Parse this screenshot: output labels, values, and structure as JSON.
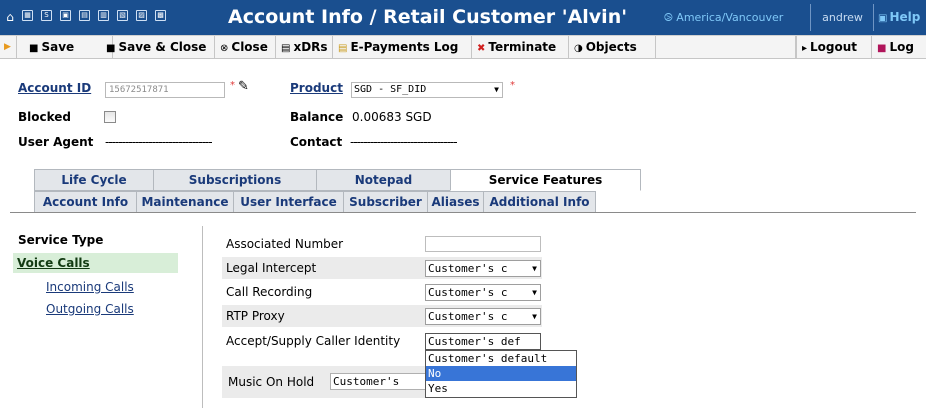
{
  "titlebar": {
    "title": "Account Info / Retail Customer 'Alvin'",
    "timezone": "⧁ America/Vancouver",
    "user": "andrew",
    "help": "Help",
    "home_icon": "⌂",
    "quick_icons": [
      "▦",
      "S",
      "▣",
      "▤",
      "▥",
      "▧",
      "▨",
      "▩"
    ]
  },
  "toolbar": {
    "save": "Save",
    "save_close": "Save & Close",
    "close": "Close",
    "xdrs": "xDRs",
    "epayments": "E-Payments Log",
    "terminate": "Terminate",
    "objects": "Objects",
    "logout": "Logout",
    "log": "Log",
    "icons": {
      "save": "■",
      "save_close": "■",
      "close": "⊗",
      "xdrs": "▤",
      "epayments": "▤",
      "terminate": "✖",
      "objects": "◑",
      "logout": "▸",
      "log": "■"
    },
    "icon_colors": {
      "terminate": "#d0201e",
      "log": "#b0145a",
      "epayments": "#c99a1a"
    }
  },
  "header": {
    "account_id_label": "Account ID",
    "account_id_value": "15672517871",
    "product_label": "Product",
    "product_value": "SGD - SF_DID",
    "blocked_label": "Blocked",
    "balance_label": "Balance",
    "balance_value": "0.00683 SGD",
    "user_agent_label": "User Agent",
    "user_agent_value": "--------------------------------",
    "contact_label": "Contact",
    "contact_value": "--------------------------------",
    "required_mark": "*"
  },
  "tabs": {
    "row1": [
      "Life Cycle",
      "Subscriptions",
      "Notepad",
      "Service Features"
    ],
    "row2": [
      "Account Info",
      "Maintenance",
      "User Interface",
      "Subscriber",
      "Aliases",
      "Additional Info"
    ]
  },
  "nav": {
    "heading": "Service Type",
    "active": "Voice Calls",
    "items": [
      "Incoming Calls",
      "Outgoing Calls"
    ]
  },
  "form": {
    "associated_number": "Associated Number",
    "legal_intercept": "Legal Intercept",
    "legal_intercept_value": "Customer's c",
    "call_recording": "Call Recording",
    "call_recording_value": "Customer's c",
    "rtp_proxy": "RTP Proxy",
    "rtp_proxy_value": "Customer's c",
    "accept_supply": "Accept/Supply Caller Identity",
    "accept_supply_value": "Customer's def",
    "music_on_hold": "Music On Hold",
    "music_on_hold_value": "Customer's"
  },
  "dropdown": {
    "options": [
      "Customer's default",
      "No",
      "Yes"
    ],
    "selected_index": 1
  }
}
